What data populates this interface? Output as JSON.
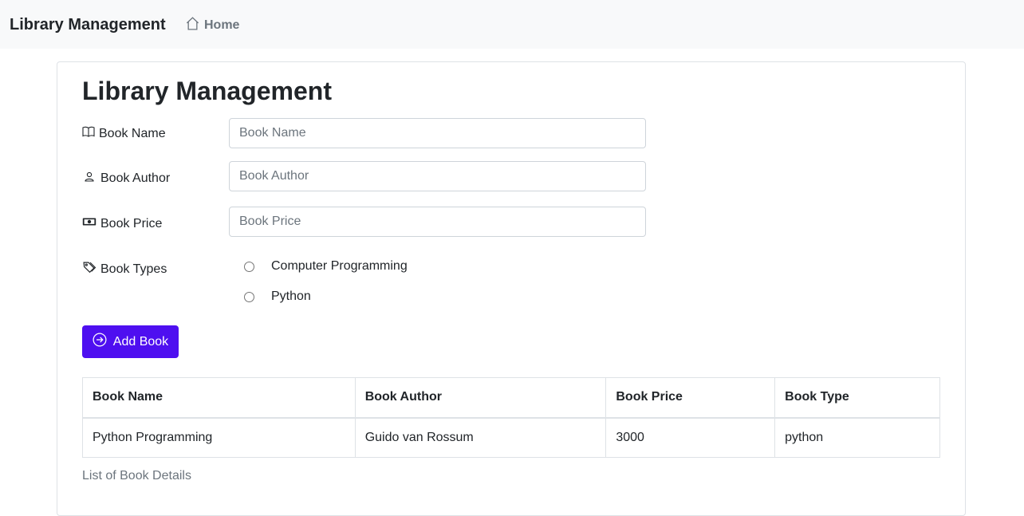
{
  "navbar": {
    "brand": "Library Management",
    "home_label": "Home"
  },
  "main": {
    "title": "Library Management",
    "form": {
      "book_name": {
        "label": "Book Name",
        "placeholder": "Book Name",
        "value": ""
      },
      "book_author": {
        "label": "Book Author",
        "placeholder": "Book Author",
        "value": ""
      },
      "book_price": {
        "label": "Book Price",
        "placeholder": "Book Price",
        "value": ""
      },
      "book_types": {
        "label": "Book Types",
        "options": [
          "Computer Programming",
          "Python"
        ],
        "selected": null
      }
    },
    "add_button_label": "Add Book",
    "table": {
      "headers": [
        "Book Name",
        "Book Author",
        "Book Price",
        "Book Type"
      ],
      "rows": [
        [
          "Python Programming",
          "Guido van Rossum",
          "3000",
          "python"
        ]
      ]
    },
    "caption": "List of Book Details"
  },
  "colors": {
    "accent": "#4e0ff0",
    "navbar_bg": "#f8f9fa",
    "muted_text": "#6c757d",
    "border": "#dee2e6"
  },
  "icons": {
    "home": "home-icon",
    "book_name": "book-icon",
    "book_author": "person-icon",
    "book_price": "cash-icon",
    "book_types": "tags-icon",
    "add_button": "arrow-right-circle-icon"
  }
}
